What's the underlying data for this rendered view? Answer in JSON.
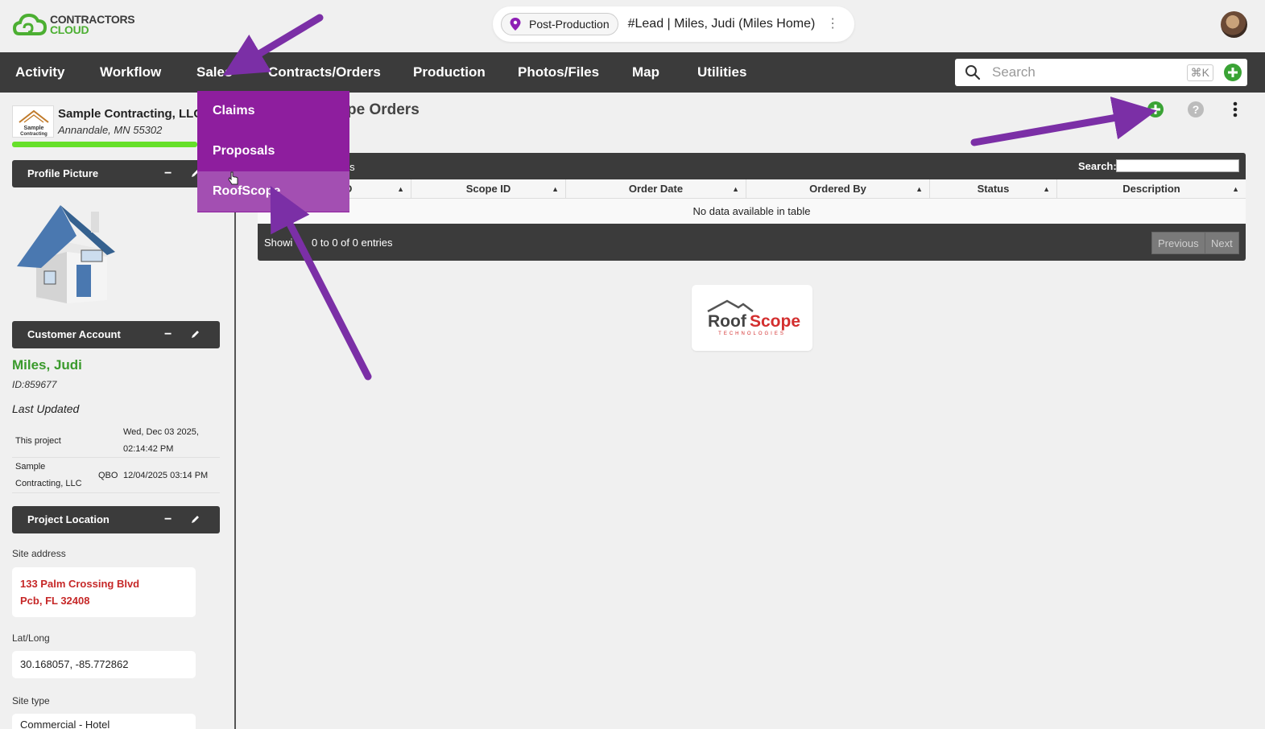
{
  "header": {
    "logo_line1": "CONTRACTORS",
    "logo_line2": "CLOUD",
    "stage": "Post-Production",
    "lead_title": "#Lead | Miles, Judi (Miles Home)"
  },
  "nav": {
    "items": [
      "Activity",
      "Workflow",
      "Sales",
      "Contracts/Orders",
      "Production",
      "Photos/Files",
      "Map",
      "Utilities"
    ],
    "search_placeholder": "Search",
    "search_shortcut": "⌘K"
  },
  "sales_dropdown": {
    "items": [
      "Claims",
      "Proposals",
      "RoofScope"
    ],
    "active": "RoofScope"
  },
  "sidebar": {
    "company_name": "Sample Contracting, LLC",
    "company_address": "Annandale, MN 55302",
    "company_logo_text": "Sample Contracting",
    "panels": {
      "profile_picture": "Profile Picture",
      "customer_account": "Customer Account",
      "project_location": "Project Location"
    },
    "customer_name": "Miles, Judi",
    "customer_id": "ID:859677",
    "last_updated_label": "Last Updated",
    "last_updated": {
      "row1_label": "This project",
      "row1_value_line1": "Wed, Dec 03 2025,",
      "row1_value_line2": "02:14:42 PM",
      "row2_label_line1": "Sample",
      "row2_label_line2": "Contracting, LLC",
      "row2_mid": "QBO",
      "row2_value": "12/04/2025 03:14 PM"
    },
    "site_address_label": "Site address",
    "site_address_line1": "133 Palm Crossing Blvd",
    "site_address_line2": "Pcb, FL 32408",
    "latlong_label": "Lat/Long",
    "latlong": "30.168057, -85.772862",
    "site_type_label": "Site type",
    "site_type": "Commercial - Hotel"
  },
  "main": {
    "title_visible": "pe Orders",
    "entries_visible": "ies",
    "search_label": "Search:",
    "columns": [
      "D",
      "Scope ID",
      "Order Date",
      "Ordered By",
      "Status",
      "Description"
    ],
    "empty_message": "No data available in table",
    "info_left": "Showi",
    "info_right": "0 to 0 of 0 entries",
    "prev_label": "Previous",
    "next_label": "Next",
    "roofscope_word1": "Roof",
    "roofscope_word2": "Scope",
    "roofscope_sub": "TECHNOLOGIES"
  },
  "colors": {
    "nav_bg": "#3b3b3b",
    "dropdown_bg": "#8e1e9e",
    "dropdown_active": "#a34fb2",
    "brand_green": "#4caf32",
    "annotation_arrow": "#7b2fa6",
    "address_red": "#c62828"
  }
}
